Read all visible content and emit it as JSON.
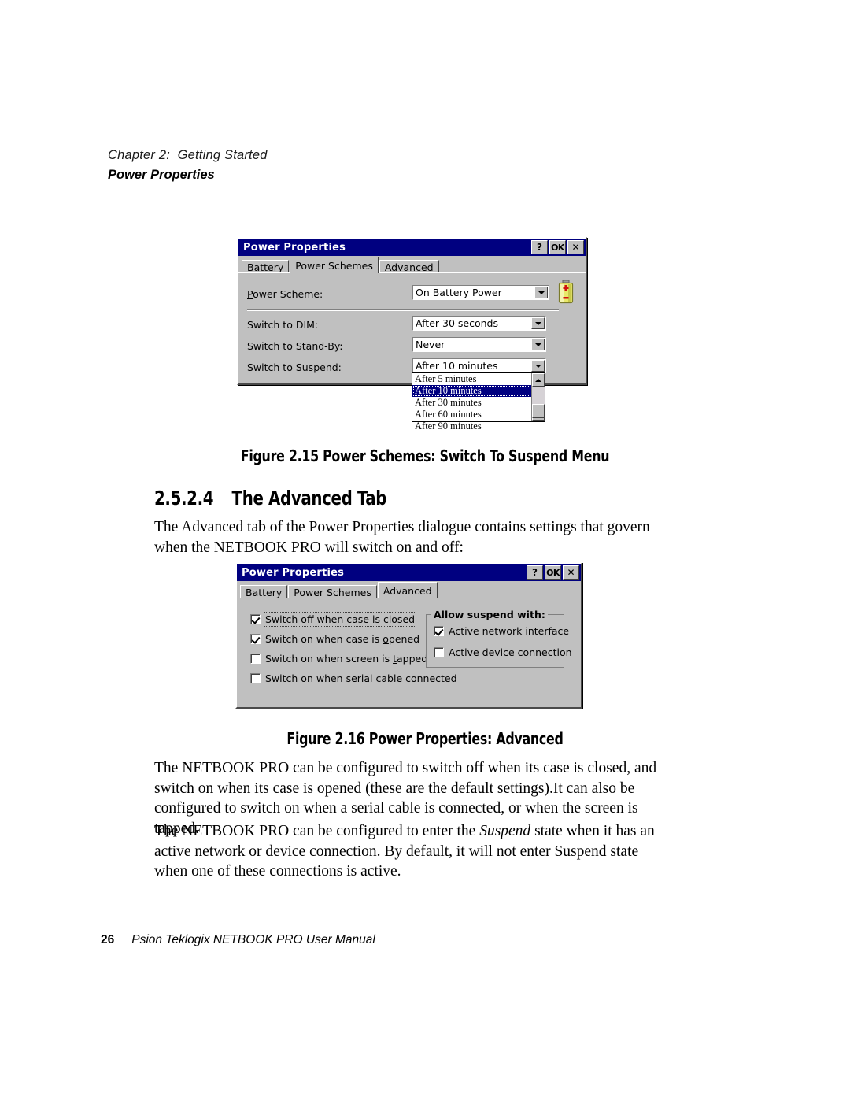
{
  "page": {
    "chapter": "Chapter 2:  Getting Started",
    "header_sub": "Power Properties",
    "footer_page_number": "26",
    "footer_text": "Psion Teklogix NETBOOK PRO User Manual"
  },
  "figure_215": {
    "caption": "Figure 2.15 Power Schemes: Switch To Suspend Menu",
    "dialog": {
      "title": "Power Properties",
      "sys_buttons": {
        "help": "?",
        "ok": "OK",
        "close": "✕"
      },
      "tabs": [
        {
          "label": "Battery",
          "active": false
        },
        {
          "label": "Power Schemes",
          "active": true
        },
        {
          "label": "Advanced",
          "active": false
        }
      ],
      "rows": [
        {
          "label_pre": "",
          "label_acc": "P",
          "label_post": "ower Scheme:",
          "value": "On Battery Power"
        },
        {
          "label_pre": "Switch to DIM:",
          "label_acc": "",
          "label_post": "",
          "value": "After 30 seconds"
        },
        {
          "label_pre": "Switch to Stand-By:",
          "label_acc": "",
          "label_post": "",
          "value": "Never"
        },
        {
          "label_pre": "Switch to Suspend:",
          "label_acc": "",
          "label_post": "",
          "value": "After 10 minutes"
        }
      ],
      "battery_icon": "battery-icon",
      "dropdown": {
        "open": true,
        "selected": "After 10 minutes",
        "options": [
          "After 5 minutes",
          "After 10 minutes",
          "After 30 minutes",
          "After 60 minutes",
          "After 90 minutes"
        ]
      }
    }
  },
  "section": {
    "number": "2.5.2.4",
    "title": "The Advanced Tab",
    "intro": "The Advanced tab of the Power Properties dialogue contains settings that govern when the NETBOOK PRO will switch on and off:"
  },
  "figure_216": {
    "caption": "Figure 2.16 Power Properties: Advanced",
    "dialog": {
      "title": "Power Properties",
      "sys_buttons": {
        "help": "?",
        "ok": "OK",
        "close": "✕"
      },
      "tabs": [
        {
          "label": "Battery",
          "active": false
        },
        {
          "label": "Power Schemes",
          "active": false
        },
        {
          "label": "Advanced",
          "active": true
        }
      ],
      "checkboxes": [
        {
          "pre": "Switch off when case is ",
          "acc": "c",
          "post": "losed",
          "checked": true,
          "focused": true
        },
        {
          "pre": "Switch on when case is ",
          "acc": "o",
          "post": "pened",
          "checked": true,
          "focused": false
        },
        {
          "pre": "Switch on when screen is ",
          "acc": "t",
          "post": "apped",
          "checked": false,
          "focused": false
        },
        {
          "pre": "Switch on when ",
          "acc": "s",
          "post": "erial cable connected",
          "checked": false,
          "focused": false
        }
      ],
      "group": {
        "title": "Allow suspend with:",
        "checkboxes": [
          {
            "pre": "Active network interface",
            "acc": "",
            "post": "",
            "checked": true
          },
          {
            "pre": "Active device connection",
            "acc": "",
            "post": "",
            "checked": false
          }
        ]
      }
    }
  },
  "paragraphs": [
    "The NETBOOK PRO can be configured to switch off when its case is closed, and switch on when its case is opened (these are the default settings).It can also be configured to switch on when a serial cable is connected, or when the screen is tapped.",
    {
      "part1": "The NETBOOK PRO can be configured to enter the ",
      "italic": "Suspend",
      "part2": " state when it has an active network or device connection. By default, it will not enter Suspend state when one of these connections is active."
    }
  ],
  "colors": {
    "titlebar": "#000080",
    "dialog_face": "#c0c0c0",
    "selection": "#000080",
    "battery_body": "#e8e86a",
    "battery_plus": "#d01010"
  }
}
